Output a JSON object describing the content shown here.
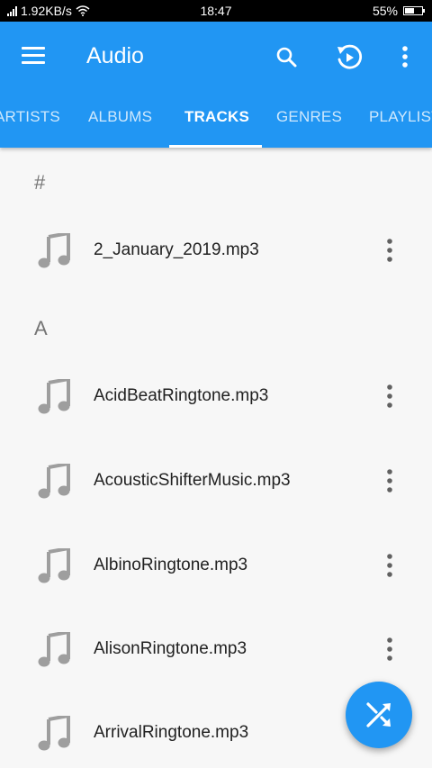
{
  "status_bar": {
    "network_speed": "1.92KB/s",
    "time": "18:47",
    "battery": "55%"
  },
  "app_bar": {
    "title": "Audio",
    "icons": [
      "menu-icon",
      "search-icon",
      "replay-icon",
      "more-vertical-icon"
    ]
  },
  "tabs": [
    {
      "label": "ARTISTS",
      "active": false
    },
    {
      "label": "ALBUMS",
      "active": false
    },
    {
      "label": "TRACKS",
      "active": true
    },
    {
      "label": "GENRES",
      "active": false
    },
    {
      "label": "PLAYLISTS",
      "active": false
    }
  ],
  "sections": [
    {
      "header": "#",
      "tracks": [
        "2_January_2019.mp3"
      ]
    },
    {
      "header": "A",
      "tracks": [
        "AcidBeatRingtone.mp3",
        "AcousticShifterMusic.mp3",
        "AlbinoRingtone.mp3",
        "AlisonRingtone.mp3",
        "ArrivalRingtone.mp3"
      ]
    }
  ],
  "fab": {
    "icon": "shuffle-icon"
  },
  "colors": {
    "primary": "#2196f3",
    "background": "#f7f7f7",
    "icon_gray": "#9e9e9e",
    "text": "#212121",
    "header_text": "#757575"
  }
}
